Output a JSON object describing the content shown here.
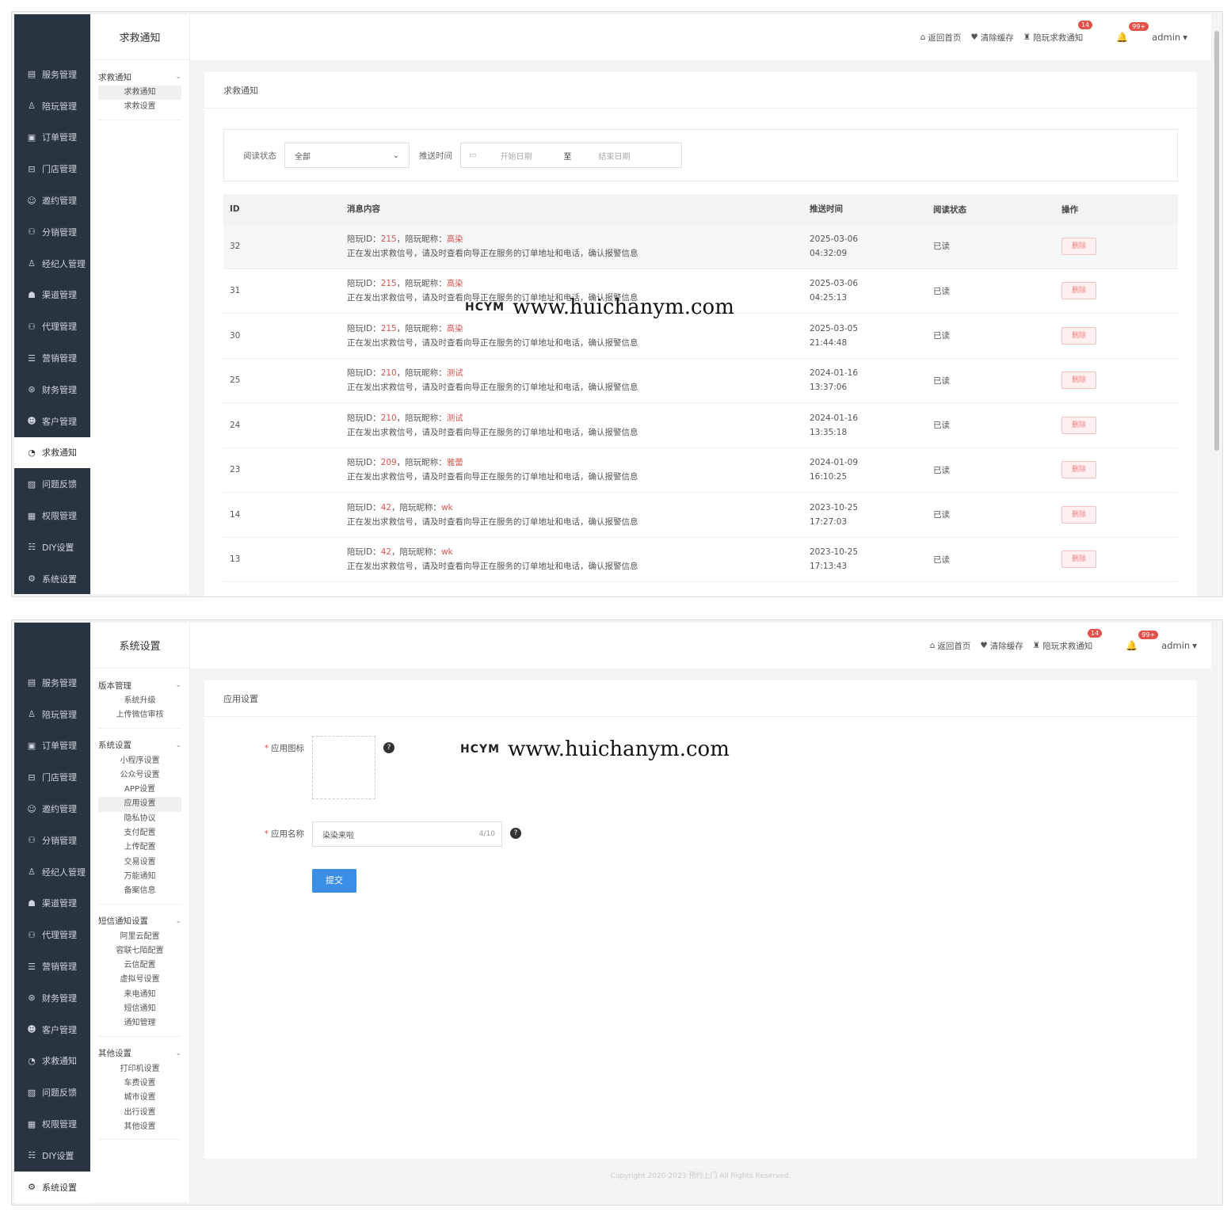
{
  "nav": [
    {
      "label": "服务管理",
      "icon": "service-icon"
    },
    {
      "label": "陪玩管理",
      "icon": "companion-icon"
    },
    {
      "label": "订单管理",
      "icon": "order-icon"
    },
    {
      "label": "门店管理",
      "icon": "store-icon"
    },
    {
      "label": "邀约管理",
      "icon": "invite-icon"
    },
    {
      "label": "分销管理",
      "icon": "distribution-icon"
    },
    {
      "label": "经纪人管理",
      "icon": "agent-icon"
    },
    {
      "label": "渠道管理",
      "icon": "channel-icon"
    },
    {
      "label": "代理管理",
      "icon": "proxy-icon"
    },
    {
      "label": "营销管理",
      "icon": "marketing-icon"
    },
    {
      "label": "财务管理",
      "icon": "finance-icon"
    },
    {
      "label": "客户管理",
      "icon": "customer-icon"
    },
    {
      "label": "求救通知",
      "icon": "bell-icon"
    },
    {
      "label": "问题反馈",
      "icon": "feedback-icon"
    },
    {
      "label": "权限管理",
      "icon": "permission-icon"
    },
    {
      "label": "DIY设置",
      "icon": "diy-icon"
    },
    {
      "label": "系统设置",
      "icon": "settings-icon"
    }
  ],
  "topbar": {
    "home": "返回首页",
    "clear_cache": "清除缓存",
    "sos_notice": "陪玩求救通知",
    "sos_badge": "14",
    "bell_badge": "99+",
    "user": "admin"
  },
  "watermark": {
    "logo": "HCYM",
    "url": "www.huichanym.com"
  },
  "screen1": {
    "sub_title": "求救通知",
    "sub_group": "求救通知",
    "sub_items": [
      "求救通知",
      "求救设置"
    ],
    "card_title": "求救通知",
    "filter": {
      "status_label": "阅读状态",
      "status_value": "全部",
      "time_label": "推送时间",
      "start_placeholder": "开始日期",
      "sep": "至",
      "end_placeholder": "结束日期"
    },
    "columns": [
      "ID",
      "消息内容",
      "推送时间",
      "阅读状态",
      "操作"
    ],
    "rows": [
      {
        "id": "32",
        "pid_label": "陪玩ID：",
        "pid": "215",
        "nick_label": "，陪玩昵称：",
        "nick": "高染",
        "msg": "正在发出求救信号，请及时查看向导正在服务的订单地址和电话，确认报警信息",
        "date": "2025-03-06",
        "time": "04:32:09",
        "status": "已读",
        "op": "删除"
      },
      {
        "id": "31",
        "pid_label": "陪玩ID：",
        "pid": "215",
        "nick_label": "，陪玩昵称：",
        "nick": "高染",
        "msg": "正在发出求救信号，请及时查看向导正在服务的订单地址和电话，确认报警信息",
        "date": "2025-03-06",
        "time": "04:25:13",
        "status": "已读",
        "op": "删除"
      },
      {
        "id": "30",
        "pid_label": "陪玩ID：",
        "pid": "215",
        "nick_label": "，陪玩昵称：",
        "nick": "高染",
        "msg": "正在发出求救信号，请及时查看向导正在服务的订单地址和电话，确认报警信息",
        "date": "2025-03-05",
        "time": "21:44:48",
        "status": "已读",
        "op": "删除"
      },
      {
        "id": "25",
        "pid_label": "陪玩ID：",
        "pid": "210",
        "nick_label": "，陪玩昵称：",
        "nick": "测试",
        "msg": "正在发出求救信号，请及时查看向导正在服务的订单地址和电话，确认报警信息",
        "date": "2024-01-16",
        "time": "13:37:06",
        "status": "已读",
        "op": "删除"
      },
      {
        "id": "24",
        "pid_label": "陪玩ID：",
        "pid": "210",
        "nick_label": "，陪玩昵称：",
        "nick": "测试",
        "msg": "正在发出求救信号，请及时查看向导正在服务的订单地址和电话，确认报警信息",
        "date": "2024-01-16",
        "time": "13:35:18",
        "status": "已读",
        "op": "删除"
      },
      {
        "id": "23",
        "pid_label": "陪玩ID：",
        "pid": "209",
        "nick_label": "，陪玩昵称：",
        "nick": "雅蕾",
        "msg": "正在发出求救信号，请及时查看向导正在服务的订单地址和电话，确认报警信息",
        "date": "2024-01-09",
        "time": "16:10:25",
        "status": "已读",
        "op": "删除"
      },
      {
        "id": "14",
        "pid_label": "陪玩ID：",
        "pid": "42",
        "nick_label": "，陪玩昵称：",
        "nick": "wk",
        "msg": "正在发出求救信号，请及时查看向导正在服务的订单地址和电话，确认报警信息",
        "date": "2023-10-25",
        "time": "17:27:03",
        "status": "已读",
        "op": "删除"
      },
      {
        "id": "13",
        "pid_label": "陪玩ID：",
        "pid": "42",
        "nick_label": "，陪玩昵称：",
        "nick": "wk",
        "msg": "正在发出求救信号，请及时查看向导正在服务的订单地址和电话，确认报警信息",
        "date": "2023-10-25",
        "time": "17:13:43",
        "status": "已读",
        "op": "删除"
      }
    ]
  },
  "screen2": {
    "sub_title": "系统设置",
    "groups": [
      {
        "title": "版本管理",
        "items": [
          "系统升级",
          "上传微信审核"
        ]
      },
      {
        "title": "系统设置",
        "items": [
          "小程序设置",
          "公众号设置",
          "APP设置",
          "应用设置",
          "隐私协议",
          "支付配置",
          "上传配置",
          "交易设置",
          "万能通知",
          "备案信息"
        ]
      },
      {
        "title": "短信通知设置",
        "items": [
          "阿里云配置",
          "容联七陌配置",
          "云信配置",
          "虚拟号设置",
          "来电通知",
          "短信通知",
          "通知管理"
        ]
      },
      {
        "title": "其他设置",
        "items": [
          "打印机设置",
          "车费设置",
          "城市设置",
          "出行设置",
          "其他设置"
        ]
      }
    ],
    "card_title": "应用设置",
    "form": {
      "req": "*",
      "icon_label": "应用图标",
      "name_label": "应用名称",
      "name_value": "染染来啦",
      "name_count": "4/10",
      "help": "?",
      "submit": "提交"
    },
    "footer": "Copyright 2020-2023 预约上门 All Rights Reserved."
  }
}
